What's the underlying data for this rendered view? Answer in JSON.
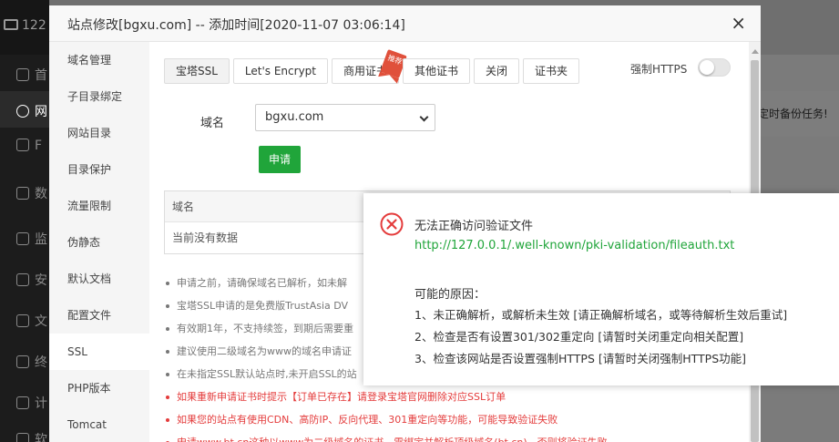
{
  "background": {
    "logo_text": "122",
    "nav_glyphs": [
      "首",
      "网",
      "F",
      "数",
      "监",
      "安",
      "文",
      "终",
      "计",
      "软"
    ],
    "card_text": "定时备份任务!"
  },
  "modal": {
    "title": "站点修改[bgxu.com] -- 添加时间[2020-11-07 03:06:14]",
    "close_label": "×",
    "sidebar_items": [
      "域名管理",
      "子目录绑定",
      "网站目录",
      "目录保护",
      "流量限制",
      "伪静态",
      "默认文档",
      "配置文件",
      "SSL",
      "PHP版本",
      "Tomcat"
    ],
    "active_sidebar_item": "SSL",
    "tabs": [
      "宝塔SSL",
      "Let's Encrypt",
      "商用证书",
      "其他证书",
      "关闭",
      "证书夹"
    ],
    "active_tab": "宝塔SSL",
    "ribbon_text": "推荐",
    "force_https_label": "强制HTTPS",
    "force_https_enabled": false,
    "domain_label": "域名",
    "domain_value": "bgxu.com",
    "apply_label": "申请",
    "table": {
      "header": "域名",
      "empty_text": "当前没有数据"
    },
    "notes": [
      {
        "text": "申请之前，请确保域名已解析，如未解",
        "red": false
      },
      {
        "text": "宝塔SSL申请的是免费版TrustAsia DV",
        "red": false
      },
      {
        "text": "有效期1年，不支持续签，到期后需要重",
        "red": false
      },
      {
        "text": "建议使用二级域名为www的域名申请证",
        "red": false
      },
      {
        "text": "在未指定SSL默认站点时,未开启SSL的站",
        "red": false
      },
      {
        "text": "如果重新申请证书时提示【订单已存在】请登录宝塔官网删除对应SSL订单",
        "red": true
      },
      {
        "text": "如果您的站点有使用CDN、高防IP、反向代理、301重定向等功能，可能导致验证失败",
        "red": true
      },
      {
        "text": "申请www.bt.cn这种以www为二级域名的证书，需绑定并解析顶级域名(bt.cn)，否则将验证失败",
        "red": true
      }
    ]
  },
  "popup": {
    "title": "无法正确访问验证文件",
    "url": "http://127.0.0.1/.well-known/pki-validation/fileauth.txt",
    "reason_heading": "可能的原因：",
    "reasons": [
      "1、未正确解析，或解析未生效 [请正确解析域名，或等待解析生效后重试]",
      "2、检查是否有设置301/302重定向 [请暂时关闭重定向相关配置]",
      "3、检查该网站是否设置强制HTTPS [请暂时关闭强制HTTPS功能]"
    ],
    "icon_color": "#e43c3c"
  }
}
